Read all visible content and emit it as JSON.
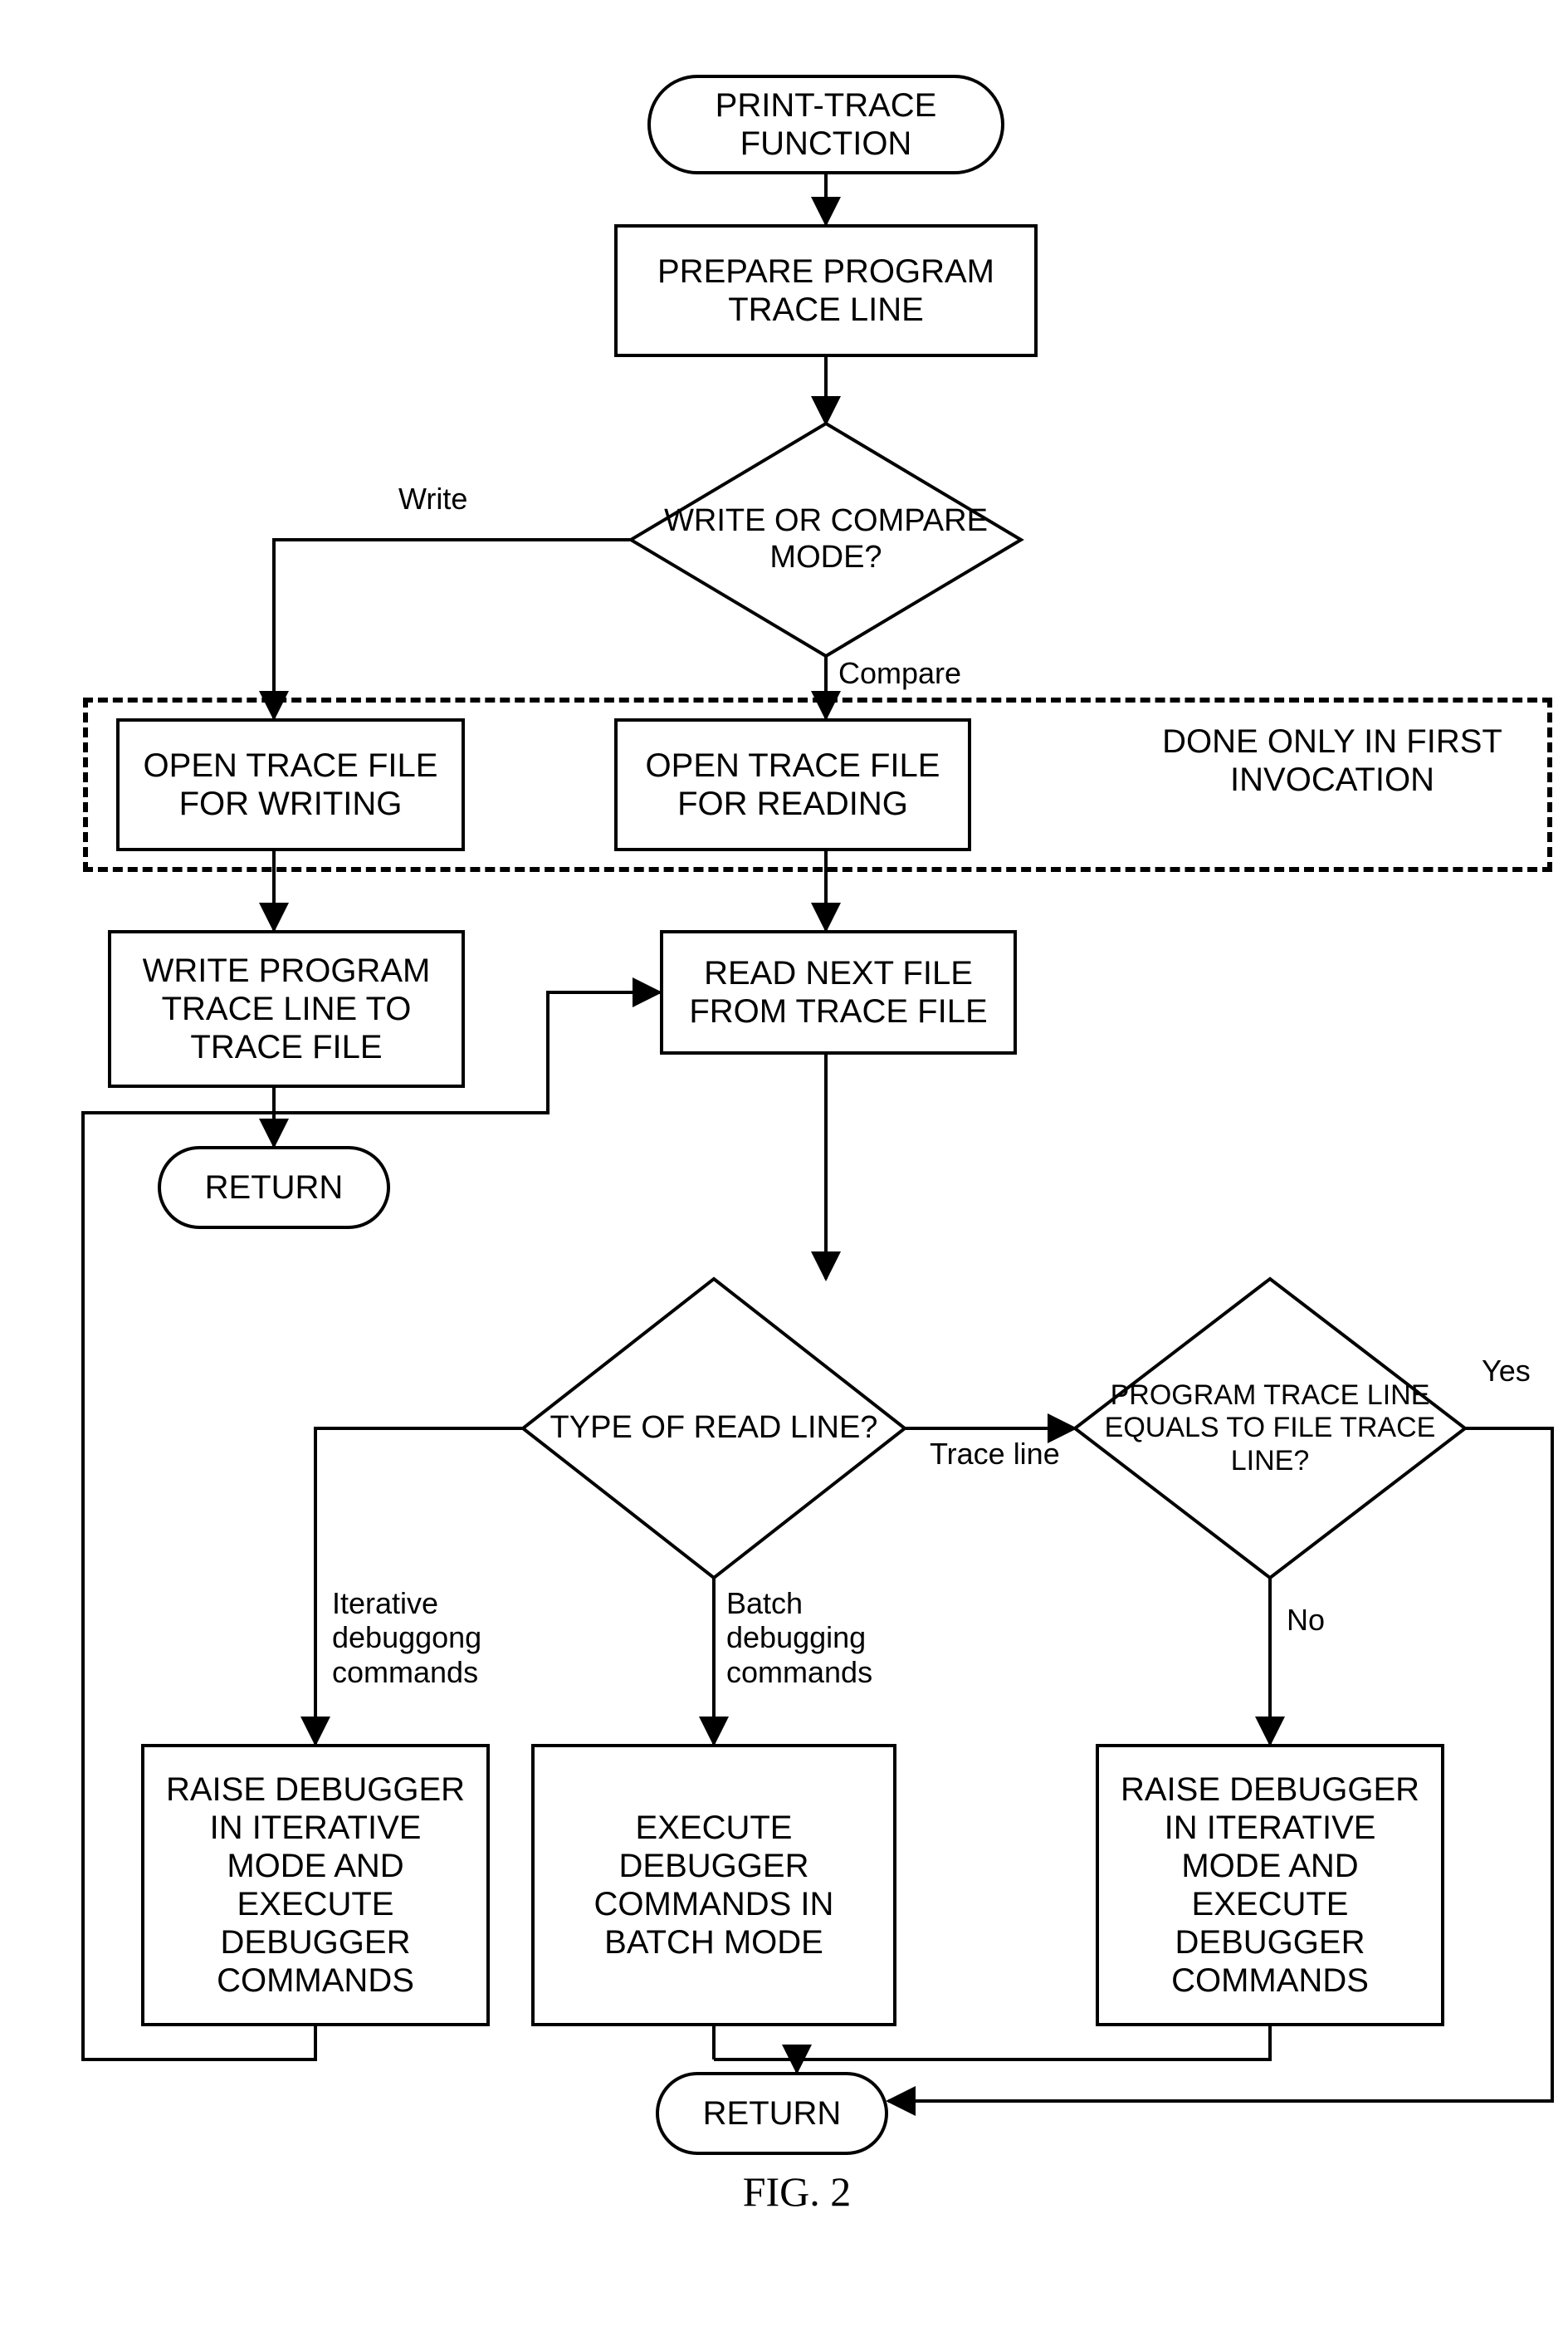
{
  "chart_data": {
    "type": "flowchart",
    "title": "FIG. 2",
    "nodes": [
      {
        "id": "n1",
        "type": "terminator",
        "text": "PRINT-TRACE FUNCTION"
      },
      {
        "id": "n2",
        "type": "process",
        "text": "PREPARE PROGRAM TRACE LINE"
      },
      {
        "id": "n3",
        "type": "decision",
        "text": "WRITE OR COMPARE MODE?"
      },
      {
        "id": "n4",
        "type": "process",
        "text": "OPEN TRACE FILE FOR WRITING"
      },
      {
        "id": "n5",
        "type": "process",
        "text": "OPEN TRACE FILE FOR READING"
      },
      {
        "id": "n6",
        "type": "annotation",
        "text": "DONE ONLY IN FIRST INVOCATION"
      },
      {
        "id": "n7",
        "type": "process",
        "text": "WRITE PROGRAM TRACE LINE TO TRACE FILE"
      },
      {
        "id": "n8",
        "type": "terminator",
        "text": "RETURN"
      },
      {
        "id": "n9",
        "type": "process",
        "text": "READ NEXT FILE FROM TRACE FILE"
      },
      {
        "id": "n10",
        "type": "decision",
        "text": "TYPE OF READ LINE?"
      },
      {
        "id": "n11",
        "type": "decision",
        "text": "PROGRAM TRACE LINE EQUALS TO FILE TRACE LINE?"
      },
      {
        "id": "n12",
        "type": "process",
        "text": "RAISE DEBUGGER IN ITERATIVE MODE AND EXECUTE DEBUGGER COMMANDS"
      },
      {
        "id": "n13",
        "type": "process",
        "text": "EXECUTE DEBUGGER COMMANDS IN BATCH MODE"
      },
      {
        "id": "n14",
        "type": "process",
        "text": "RAISE DEBUGGER IN ITERATIVE MODE AND EXECUTE DEBUGGER COMMANDS"
      },
      {
        "id": "n15",
        "type": "terminator",
        "text": "RETURN"
      }
    ],
    "edges": [
      {
        "from": "n1",
        "to": "n2",
        "label": ""
      },
      {
        "from": "n2",
        "to": "n3",
        "label": ""
      },
      {
        "from": "n3",
        "to": "n4",
        "label": "Write"
      },
      {
        "from": "n3",
        "to": "n5",
        "label": "Compare"
      },
      {
        "from": "n4",
        "to": "n7",
        "label": ""
      },
      {
        "from": "n7",
        "to": "n8",
        "label": ""
      },
      {
        "from": "n5",
        "to": "n9",
        "label": ""
      },
      {
        "from": "n9",
        "to": "n10",
        "label": ""
      },
      {
        "from": "n10",
        "to": "n12",
        "label": "Iterative debuggong commands"
      },
      {
        "from": "n10",
        "to": "n13",
        "label": "Batch debugging commands"
      },
      {
        "from": "n10",
        "to": "n11",
        "label": "Trace line"
      },
      {
        "from": "n11",
        "to": "n14",
        "label": "No"
      },
      {
        "from": "n11",
        "to": "n15",
        "label": "Yes"
      },
      {
        "from": "n12",
        "to": "n9",
        "label": ""
      },
      {
        "from": "n13",
        "to": "n15",
        "label": ""
      },
      {
        "from": "n14",
        "to": "n15",
        "label": ""
      }
    ],
    "groups": [
      {
        "note": "DONE ONLY IN FIRST INVOCATION",
        "members": [
          "n4",
          "n5"
        ],
        "style": "dashed"
      }
    ]
  },
  "nodes": {
    "n1": "PRINT-TRACE FUNCTION",
    "n2": "PREPARE PROGRAM TRACE LINE",
    "n3": "WRITE OR COMPARE MODE?",
    "n4": "OPEN TRACE FILE FOR WRITING",
    "n5": "OPEN TRACE FILE FOR READING",
    "n6": "DONE ONLY IN FIRST INVOCATION",
    "n7": "WRITE PROGRAM TRACE LINE TO TRACE FILE",
    "n8": "RETURN",
    "n9": "READ NEXT FILE FROM TRACE FILE",
    "n10": "TYPE OF READ LINE?",
    "n11": "PROGRAM TRACE LINE EQUALS TO FILE TRACE LINE?",
    "n12": "RAISE DEBUGGER IN ITERATIVE MODE AND EXECUTE DEBUGGER COMMANDS",
    "n13": "EXECUTE DEBUGGER COMMANDS IN BATCH MODE",
    "n14": "RAISE DEBUGGER IN ITERATIVE MODE AND EXECUTE DEBUGGER COMMANDS",
    "n15": "RETURN"
  },
  "edge_labels": {
    "e_write": "Write",
    "e_compare": "Compare",
    "e_iter": "Iterative debuggong commands",
    "e_batch": "Batch debugging commands",
    "e_trace": "Trace line",
    "e_yes": "Yes",
    "e_no": "No"
  },
  "caption": "FIG. 2"
}
